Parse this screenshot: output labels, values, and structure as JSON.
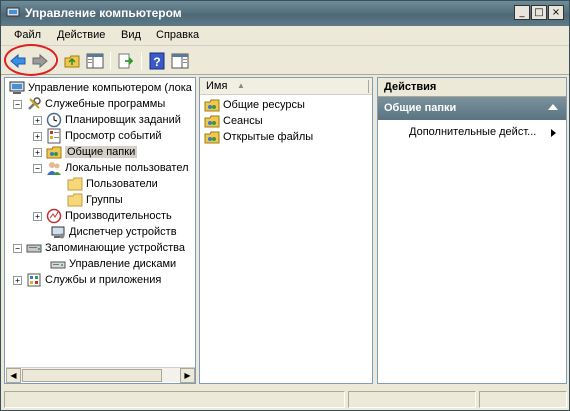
{
  "window": {
    "title": "Управление компьютером"
  },
  "titlebar_buttons": {
    "minimize": "_",
    "maximize": "□",
    "close": "×"
  },
  "menu": [
    {
      "label": "Файл"
    },
    {
      "label": "Действие"
    },
    {
      "label": "Вид"
    },
    {
      "label": "Справка"
    }
  ],
  "toolbar": {
    "back_icon": "back-arrow-icon",
    "forward_icon": "forward-arrow-icon",
    "up_icon": "up-folder-icon",
    "show_hide_tree_icon": "console-tree-icon",
    "export_icon": "export-list-icon",
    "help_icon": "help-icon",
    "action_pane_icon": "action-pane-icon"
  },
  "tree": {
    "root": "Управление компьютером (лока",
    "system_tools": "Служебные программы",
    "task_scheduler": "Планировщик заданий",
    "event_viewer": "Просмотр событий",
    "shared_folders": "Общие папки",
    "local_users": "Локальные пользовател",
    "users": "Пользователи",
    "groups": "Группы",
    "performance": "Производительность",
    "device_manager": "Диспетчер устройств",
    "storage": "Запоминающие устройства",
    "disk_management": "Управление дисками",
    "services_apps": "Службы и приложения"
  },
  "list": {
    "column_name": "Имя",
    "items": [
      "Общие ресурсы",
      "Сеансы",
      "Открытые файлы"
    ]
  },
  "actions": {
    "title": "Действия",
    "group": "Общие папки",
    "item": "Дополнительные дейст..."
  },
  "colors": {
    "titlebar": "#56707d",
    "selected": "#d4d0c8",
    "highlight_ring": "#e02020"
  }
}
